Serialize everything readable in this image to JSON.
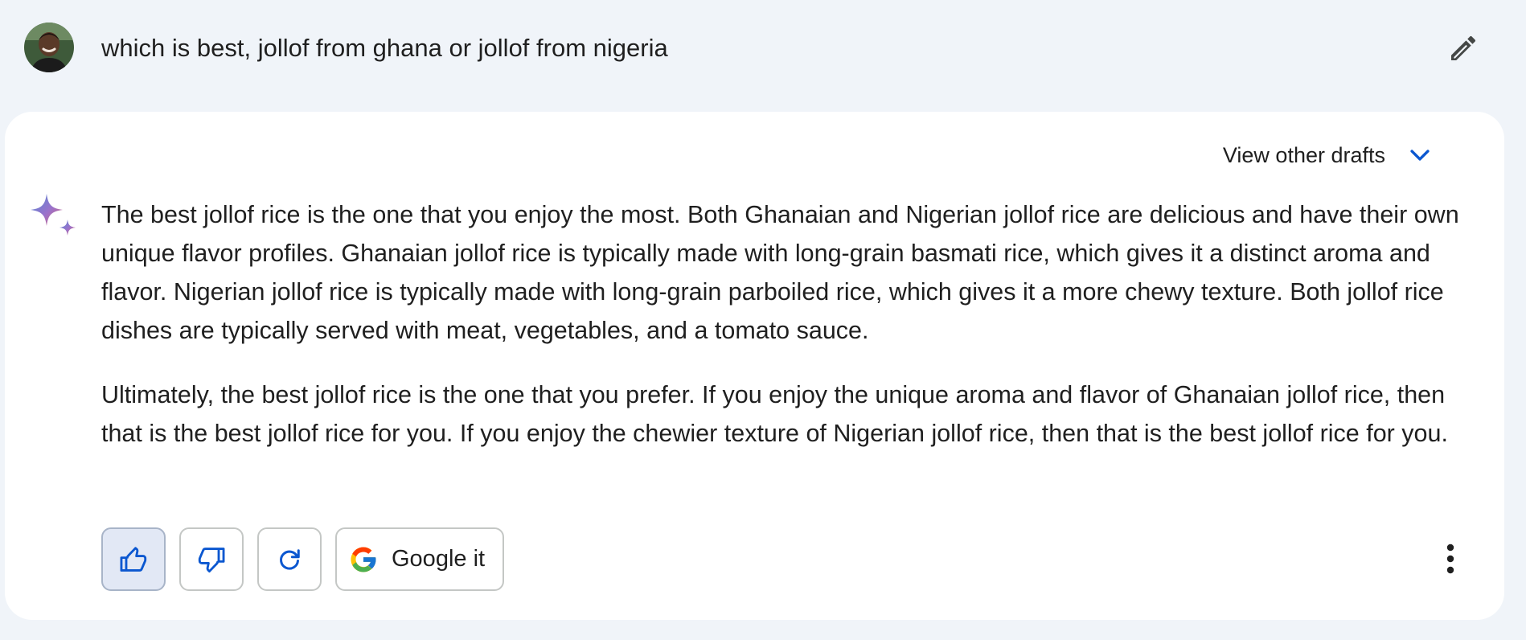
{
  "prompt": {
    "text": "which is best, jollof from ghana or jollof from nigeria",
    "edit_icon": "pencil-icon",
    "avatar": "user-avatar"
  },
  "response": {
    "drafts_label": "View other drafts",
    "drafts_icon": "chevron-down-icon",
    "model_icon": "sparkle-icon",
    "paragraphs": [
      "The best jollof rice is the one that you enjoy the most. Both Ghanaian and Nigerian jollof rice are delicious and have their own unique flavor profiles. Ghanaian jollof rice is typically made with long-grain basmati rice, which gives it a distinct aroma and flavor. Nigerian jollof rice is typically made with long-grain parboiled rice, which gives it a more chewy texture. Both jollof rice dishes are typically served with meat, vegetables, and a tomato sauce.",
      "Ultimately, the best jollof rice is the one that you prefer. If you enjoy the unique aroma and flavor of Ghanaian jollof rice, then that is the best jollof rice for you. If you enjoy the chewier texture of Nigerian jollof rice, then that is the best jollof rice for you."
    ]
  },
  "actions": {
    "thumbs_up_icon": "thumbs-up-icon",
    "thumbs_down_icon": "thumbs-down-icon",
    "regenerate_icon": "refresh-icon",
    "google_label": "Google it",
    "google_icon": "google-g-icon",
    "more_icon": "more-vertical-icon"
  },
  "colors": {
    "page_background": "#f0f4f9",
    "card_background": "#ffffff",
    "accent_blue": "#0b57d0",
    "active_button": "#e2e8f5"
  }
}
